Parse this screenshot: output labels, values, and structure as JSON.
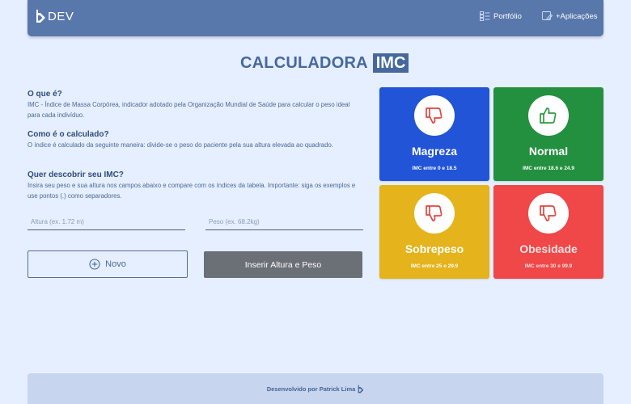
{
  "header": {
    "logo_text": "DEV",
    "nav": [
      {
        "label": "Portfólio",
        "icon": "portfolio-icon"
      },
      {
        "label": "+Aplicações",
        "icon": "apps-icon"
      }
    ]
  },
  "title": {
    "main": "CALCULADORA",
    "highlight": "IMC"
  },
  "sections": [
    {
      "heading": "O que é?",
      "text": "IMC - Índice de Massa Corpórea, indicador adotado pela Organização Mundial de Saúde para calcular o peso ideal para cada indivíduo."
    },
    {
      "heading": "Como é o calculado?",
      "text": "O índice é calculado da seguinte maneira: divide-se o peso do paciente pela sua altura elevada ao quadrado."
    },
    {
      "heading": "Quer descobrir seu IMC?",
      "text": "Insira seu peso e sua altura nos campos abaixo e compare com os índices da tabela. Importante: siga os exemplos e use pontos (.) como separadores."
    }
  ],
  "form": {
    "altura": {
      "placeholder": "Altura (ex. 1.72 m)",
      "value": ""
    },
    "peso": {
      "placeholder": "Peso (ex. 68.2kg)",
      "value": ""
    },
    "novo_label": "Novo",
    "inserir_label": "Inserir Altura e Peso"
  },
  "cards": [
    {
      "name": "Magreza",
      "range": "IMC entre 0 e 18.5",
      "color": "#2154d6",
      "icon": "thumbs-down-icon"
    },
    {
      "name": "Normal",
      "range": "IMC entre 18.6 e 24.9",
      "color": "#23903f",
      "icon": "thumbs-up-icon"
    },
    {
      "name": "Sobrepeso",
      "range": "IMC entre 25 e 29.9",
      "color": "#e5b31b",
      "icon": "thumbs-down-icon"
    },
    {
      "name": "Obesidade",
      "range": "IMC entre 30 e 99.9",
      "color": "#f04749",
      "icon": "thumbs-down-icon"
    }
  ],
  "footer": {
    "text": "Desenvolvido por Patrick Lima"
  },
  "colors": {
    "header": "#5877ab",
    "title": "#46689e",
    "thumbs_red": "#e0463f",
    "thumbs_green": "#2f9a46"
  }
}
